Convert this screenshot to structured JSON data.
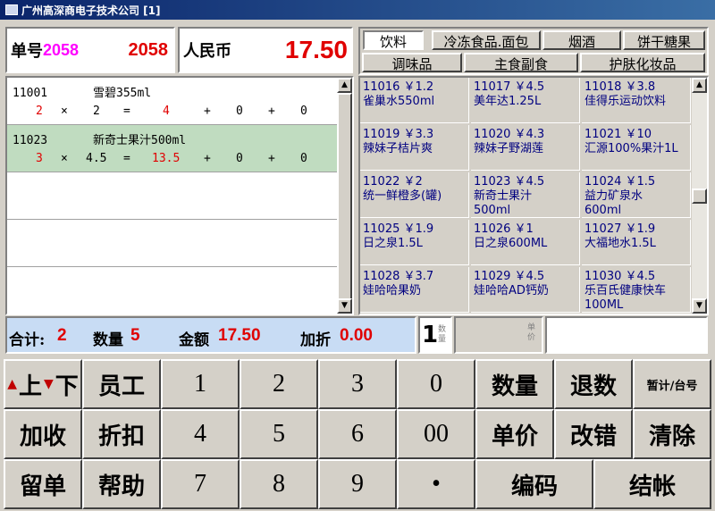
{
  "window": {
    "title": "广州高深商电子技术公司 [1]"
  },
  "order": {
    "label": "单号",
    "number_purple": "2058",
    "number_red": "2058"
  },
  "currency": {
    "label": "人民币",
    "amount": "17.50"
  },
  "items": [
    {
      "code": "11001",
      "name": "雪碧355ml",
      "qty": "2",
      "times": "×",
      "price": "2",
      "eq": "=",
      "amount": "4",
      "plus1": "+",
      "v1": "0",
      "plus2": "+",
      "v2": "0",
      "selected": false
    },
    {
      "code": "11023",
      "name": "新奇士果汁500ml",
      "qty": "3",
      "times": "×",
      "price": "4.5",
      "eq": "=",
      "amount": "13.5",
      "plus1": "+",
      "v1": "0",
      "plus2": "+",
      "v2": "0",
      "selected": true
    }
  ],
  "categories": {
    "row1": [
      "饮料",
      "冷冻食品.面包",
      "烟酒",
      "饼干糖果"
    ],
    "row2": [
      "调味品",
      "主食副食",
      "护肤化妆品"
    ],
    "selected": "饮料"
  },
  "products": [
    {
      "line1": "11016 ￥1.2",
      "line2": "雀巢水550ml",
      "line3": ""
    },
    {
      "line1": "11017 ￥4.5",
      "line2": "美年达1.25L",
      "line3": ""
    },
    {
      "line1": "11018 ￥3.8",
      "line2": "佳得乐运动饮料",
      "line3": ""
    },
    {
      "line1": "11019 ￥3.3",
      "line2": "辣妹子桔片爽",
      "line3": ""
    },
    {
      "line1": "11020 ￥4.3",
      "line2": "辣妹子野湖莲",
      "line3": ""
    },
    {
      "line1": "11021 ￥10",
      "line2": "汇源100%果汁1L",
      "line3": ""
    },
    {
      "line1": "11022 ￥2",
      "line2": "统一鲜橙多(罐)",
      "line3": ""
    },
    {
      "line1": "11023 ￥4.5",
      "line2": "新奇士果汁",
      "line3": "500ml"
    },
    {
      "line1": "11024 ￥1.5",
      "line2": "益力矿泉水",
      "line3": "600ml"
    },
    {
      "line1": "11025 ￥1.9",
      "line2": "日之泉1.5L",
      "line3": ""
    },
    {
      "line1": "11026 ￥1",
      "line2": "日之泉600ML",
      "line3": ""
    },
    {
      "line1": "11027 ￥1.9",
      "line2": "大福地水1.5L",
      "line3": ""
    },
    {
      "line1": "11028 ￥3.7",
      "line2": "娃哈哈果奶",
      "line3": ""
    },
    {
      "line1": "11029 ￥4.5",
      "line2": "娃哈哈AD钙奶",
      "line3": ""
    },
    {
      "line1": "11030 ￥4.5",
      "line2": "乐百氏健康快车",
      "line3": "100ML"
    }
  ],
  "summary": {
    "total_label": "合计:",
    "total_value": "2",
    "qty_label": "数量",
    "qty_value": "5",
    "amount_label": "金额",
    "amount_value": "17.50",
    "discount_label": "加折",
    "discount_value": "0.00"
  },
  "qty_box": {
    "value": "1",
    "label": "数量"
  },
  "price_box": {
    "label": "单价"
  },
  "keypad": {
    "up": "上",
    "down": "下",
    "staff": "员工",
    "add_charge": "加收",
    "discount": "折扣",
    "hold": "留单",
    "help": "帮助",
    "k1": "1",
    "k2": "2",
    "k3": "3",
    "k0": "0",
    "k4": "4",
    "k5": "5",
    "k6": "6",
    "k00": "00",
    "k7": "7",
    "k8": "8",
    "k9": "9",
    "dot": "•",
    "quantity": "数量",
    "return_qty": "退数",
    "subtotal": "暂计/台号",
    "unit_price": "单价",
    "correct": "改错",
    "clear": "清除",
    "code": "编码",
    "checkout": "结帐"
  },
  "icons": {
    "app": "app-icon",
    "up_arrow": "up-arrow-icon",
    "down_arrow": "down-arrow-icon"
  },
  "colors": {
    "title_bar": "#0a246a",
    "red": "#e00000",
    "magenta": "#ff00ff",
    "navy": "#000080",
    "status_bg": "#c8dcf4",
    "selected_row": "#c0dcc0"
  }
}
